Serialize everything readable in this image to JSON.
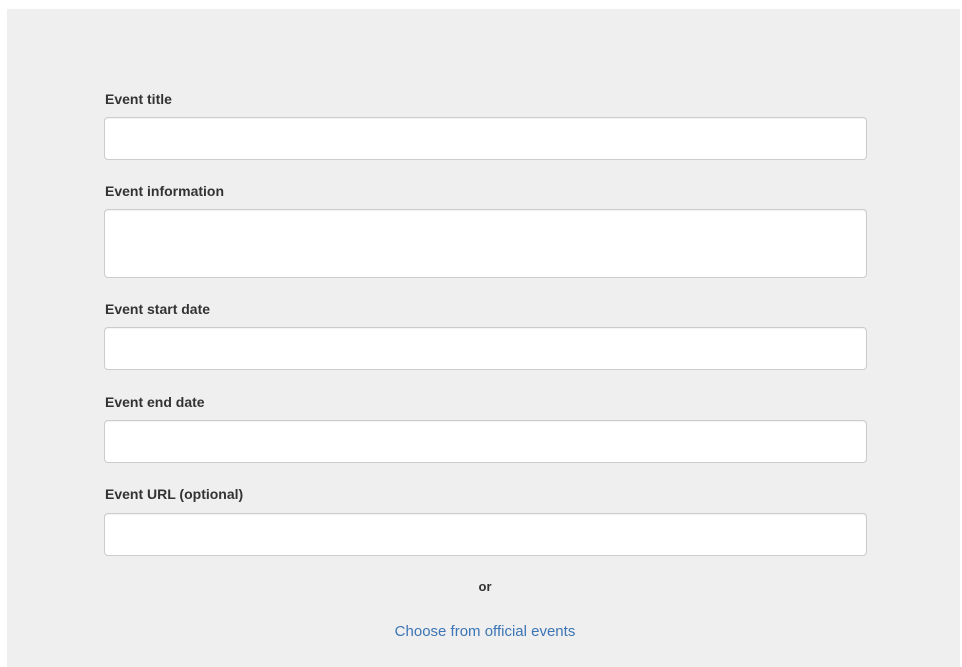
{
  "form": {
    "title": {
      "label": "Event title",
      "value": "",
      "placeholder": ""
    },
    "information": {
      "label": "Event information",
      "value": "",
      "placeholder": ""
    },
    "start_date": {
      "label": "Event start date",
      "value": "",
      "placeholder": ""
    },
    "end_date": {
      "label": "Event end date",
      "value": "",
      "placeholder": ""
    },
    "url": {
      "label": "Event URL (optional)",
      "value": "",
      "placeholder": ""
    }
  },
  "separator_text": "or",
  "official_events_link": "Choose from official events",
  "colors": {
    "panel_background": "#efefef",
    "link": "#3c75b5",
    "input_border": "#cccccc"
  }
}
